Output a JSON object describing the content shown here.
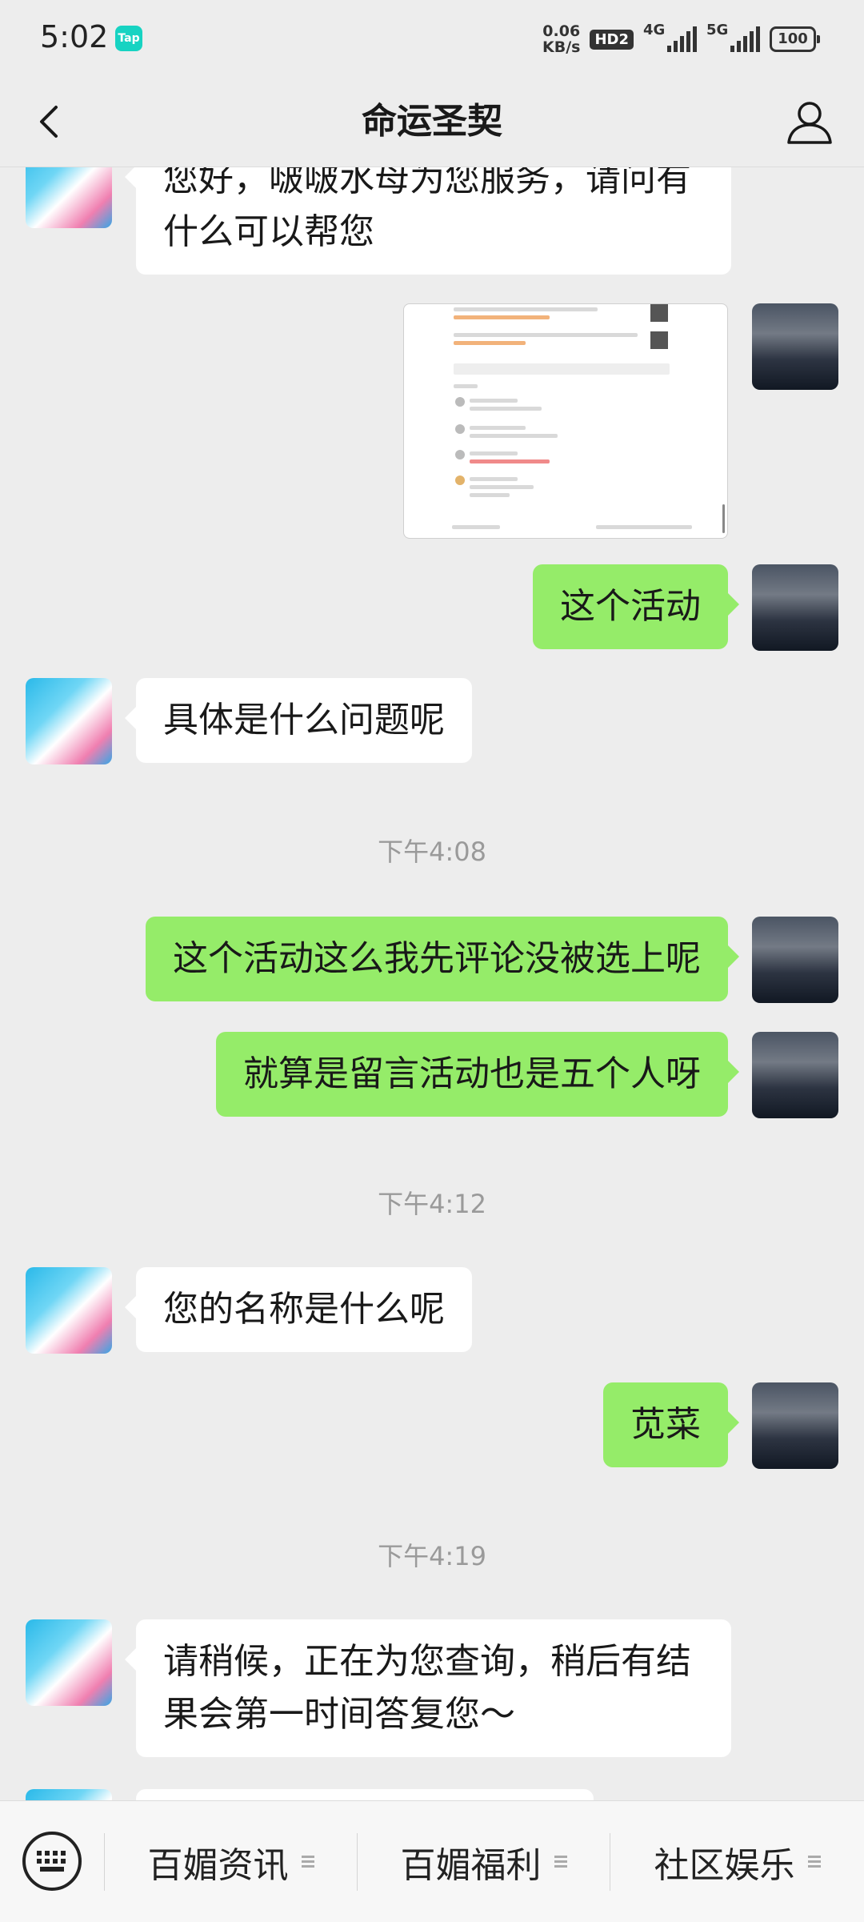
{
  "status_bar": {
    "time": "5:02",
    "app_badge": "Tap",
    "net_speed_value": "0.06",
    "net_speed_unit": "KB/s",
    "hd_label": "HD2",
    "signal1_label": "4G",
    "signal2_label": "5G",
    "battery": "100"
  },
  "header": {
    "title": "命运圣契",
    "back_icon": "chevron-left-icon",
    "profile_icon": "person-icon"
  },
  "messages": [
    {
      "from": "bot",
      "text": "您好，啵啵水母为您服务，请问有什么可以帮您"
    },
    {
      "from": "user",
      "type": "image"
    },
    {
      "from": "user",
      "text": "这个活动"
    },
    {
      "from": "bot",
      "text": "具体是什么问题呢"
    },
    {
      "type": "time",
      "text": "下午4:08"
    },
    {
      "from": "user",
      "text": "这个活动这么我先评论没被选上呢"
    },
    {
      "from": "user",
      "text": "就算是留言活动也是五个人呀"
    },
    {
      "type": "time",
      "text": "下午4:12"
    },
    {
      "from": "bot",
      "text": "您的名称是什么呢"
    },
    {
      "from": "user",
      "text": "苋菜"
    },
    {
      "type": "time",
      "text": "下午4:19"
    },
    {
      "from": "bot",
      "text": "请稍候，正在为您查询，稍后有结果会第一时间答复您～"
    }
  ],
  "bottom_menu": {
    "keyboard_icon": "keyboard-icon",
    "items": [
      "百媚资讯",
      "百媚福利",
      "社区娱乐"
    ]
  },
  "colors": {
    "background": "#ededed",
    "outgoing_bubble": "#95ec69",
    "incoming_bubble": "#ffffff"
  }
}
